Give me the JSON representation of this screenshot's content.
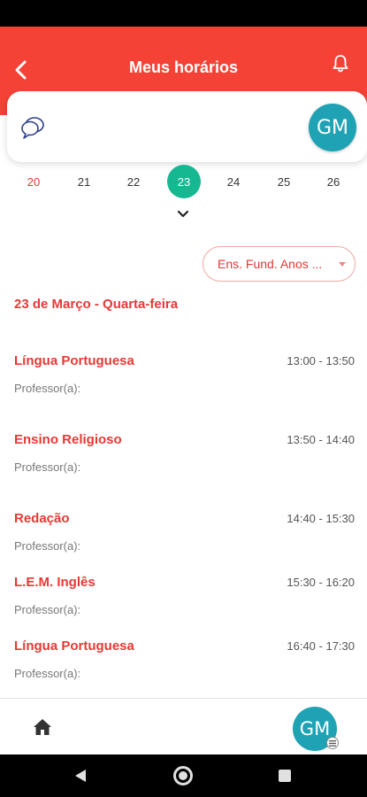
{
  "header": {
    "title": "Meus horários"
  },
  "profile": {
    "initials": "GM"
  },
  "week": {
    "days": [
      "20",
      "21",
      "22",
      "23",
      "24",
      "25",
      "26"
    ],
    "selected_index": 3
  },
  "filter": {
    "selected": "Ens. Fund. Anos ..."
  },
  "schedule": {
    "date_heading": "23 de Março - Quarta-feira",
    "lessons": [
      {
        "subject": "Língua Portuguesa",
        "time": "13:00 - 13:50",
        "teacher_label": "Professor(a):"
      },
      {
        "subject": "Ensino Religioso",
        "time": "13:50 - 14:40",
        "teacher_label": "Professor(a):"
      },
      {
        "subject": "Redação",
        "time": "14:40 - 15:30",
        "teacher_label": "Professor(a):"
      },
      {
        "subject": "L.E.M. Inglês",
        "time": "15:30 - 16:20",
        "teacher_label": "Professor(a):"
      },
      {
        "subject": "Língua Portuguesa",
        "time": "16:40 - 17:30",
        "teacher_label": "Professor(a):"
      }
    ]
  },
  "colors": {
    "primary": "#f44336",
    "selected_day": "#16b892",
    "avatar": "#1fa3b4"
  },
  "icons": [
    "back-arrow-icon",
    "bell-icon",
    "chat-icon",
    "chevron-down-icon",
    "home-icon",
    "menu-icon"
  ]
}
